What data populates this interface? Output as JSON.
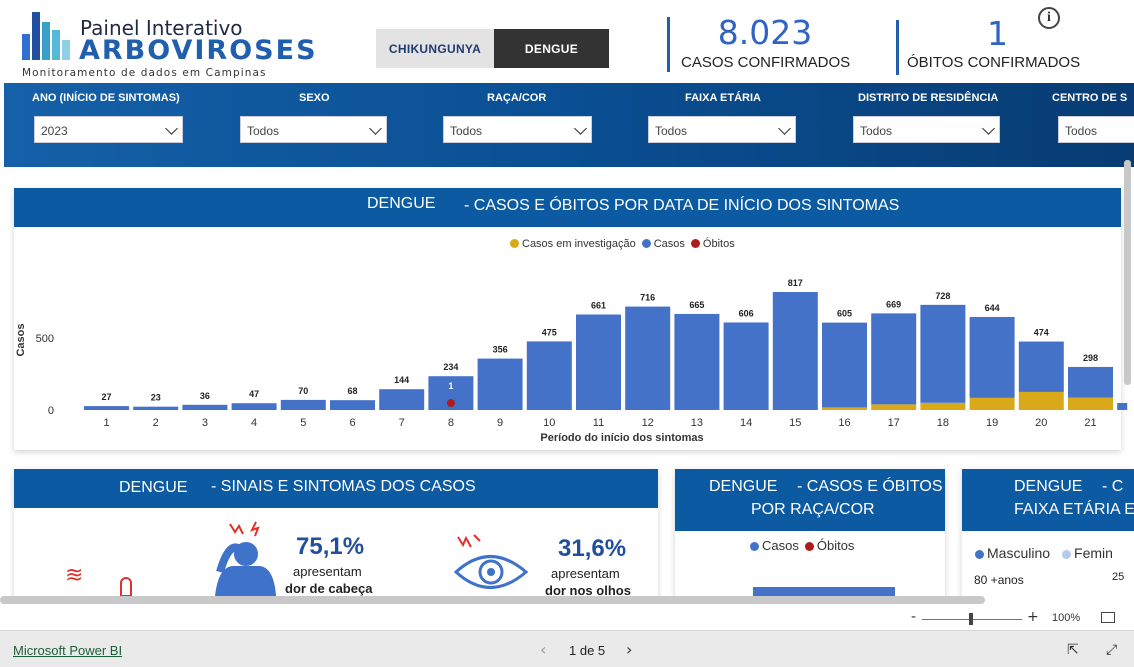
{
  "logo": {
    "line1": "Painel Interativo",
    "line2": "ARBOVIROSES",
    "line3": "Monitoramento de dados em Campinas"
  },
  "tabs": {
    "chikungunya": "CHIKUNGUNYA",
    "dengue": "DENGUE"
  },
  "kpis": {
    "cases_value": "8.023",
    "cases_label": "CASOS CONFIRMADOS",
    "deaths_value": "1",
    "deaths_label": "ÓBITOS CONFIRMADOS"
  },
  "info_icon": "info-icon",
  "filters": [
    {
      "label": "ANO (INÍCIO DE SINTOMAS)",
      "value": "2023"
    },
    {
      "label": "SEXO",
      "value": "Todos"
    },
    {
      "label": "RAÇA/COR",
      "value": "Todos"
    },
    {
      "label": "FAIXA ETÁRIA",
      "value": "Todos"
    },
    {
      "label": "DISTRITO DE RESIDÊNCIA",
      "value": "Todos"
    },
    {
      "label": "CENTRO DE S",
      "value": "Todos"
    }
  ],
  "main_panel": {
    "title_left": "DENGUE",
    "title_right": "- CASOS E ÓBITOS POR DATA DE INÍCIO DOS SINTOMAS",
    "legend": [
      "Casos em investigação",
      "Casos",
      "Óbitos"
    ]
  },
  "chart_data": {
    "type": "bar",
    "title": "",
    "xlabel": "Período do início dos sintomas",
    "ylabel": "Casos",
    "ylim": [
      0,
      900
    ],
    "yticks": [
      "0",
      "500"
    ],
    "categories": [
      "1",
      "2",
      "3",
      "4",
      "5",
      "6",
      "7",
      "8",
      "9",
      "10",
      "11",
      "12",
      "13",
      "14",
      "15",
      "16",
      "17",
      "18",
      "19",
      "20",
      "21"
    ],
    "series": [
      {
        "name": "Casos",
        "values": [
          27,
          23,
          36,
          47,
          70,
          68,
          144,
          234,
          356,
          475,
          661,
          716,
          665,
          606,
          817,
          587,
          630,
          678,
          560,
          349,
          212
        ]
      },
      {
        "name": "Casos em investigação",
        "values": [
          0,
          0,
          0,
          0,
          0,
          0,
          0,
          0,
          0,
          0,
          0,
          0,
          0,
          0,
          0,
          18,
          39,
          50,
          84,
          125,
          86
        ]
      },
      {
        "name": "Óbitos",
        "values": [
          0,
          0,
          0,
          0,
          0,
          0,
          0,
          1,
          0,
          0,
          0,
          0,
          0,
          0,
          0,
          0,
          0,
          0,
          0,
          0,
          0
        ]
      }
    ],
    "totals": [
      27,
      23,
      36,
      47,
      70,
      68,
      144,
      234,
      356,
      475,
      661,
      716,
      665,
      606,
      817,
      605,
      669,
      728,
      644,
      474,
      298
    ],
    "colors": {
      "casos": "#4472c9",
      "investigacao": "#d9a91a",
      "obitos": "#b01c1c"
    }
  },
  "symptoms_panel": {
    "title_left": "DENGUE",
    "title_right": "- SINAIS E SINTOMAS DOS CASOS",
    "item1_pct": "75,1%",
    "item1_line1": "apresentam",
    "item1_line2": "dor de cabeça",
    "item2_pct": "31,6%",
    "item2_line1": "apresentam",
    "item2_line2": "dor nos olhos"
  },
  "race_panel": {
    "title_line1_left": "DENGUE",
    "title_line1_right": "- CASOS E ÓBITOS",
    "title_line2": "POR RAÇA/COR",
    "legend": [
      "Casos",
      "Óbitos"
    ]
  },
  "age_panel": {
    "title_line1_left": "DENGUE",
    "title_line1_right": "- C",
    "title_line2": "FAIXA ETÁRIA E",
    "legend": [
      "Masculino",
      "Femin"
    ],
    "row_label": "80 +anos",
    "row_value": "25"
  },
  "zoom": {
    "minus": "-",
    "plus": "+",
    "level": "100%"
  },
  "footer": {
    "brand": "Microsoft Power BI",
    "page": "1 de 5"
  }
}
